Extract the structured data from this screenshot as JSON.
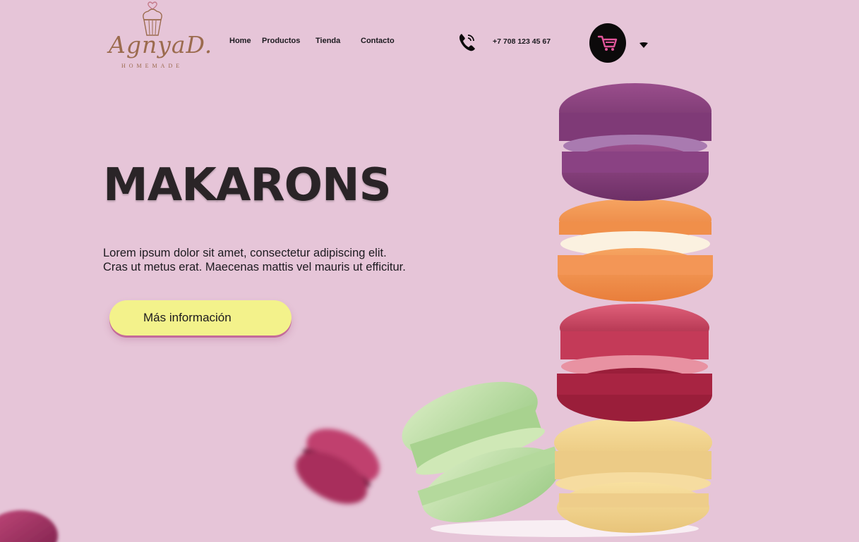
{
  "brand": {
    "name": "AgnyaD.",
    "tagline": "HOMEMADE"
  },
  "nav": {
    "items": [
      {
        "label": "Home",
        "active": true
      },
      {
        "label": "Productos",
        "active": false
      },
      {
        "label": "Tienda",
        "active": false
      },
      {
        "label": "Contacto",
        "active": false
      }
    ]
  },
  "contact": {
    "phone": "+7 708 123 45 67",
    "icon": "phone-icon"
  },
  "cart": {
    "icon": "shopping-cart-icon",
    "dropdown_icon": "caret-down-icon"
  },
  "hero": {
    "title": "MAKARONS",
    "description": "Lorem ipsum dolor sit amet, consectetur adipiscing elit. Cras ut metus erat. Maecenas mattis vel mauris ut efficitur.",
    "cta_label": "Más información"
  },
  "colors": {
    "background": "#e6c5d8",
    "cta": "#f3f28b",
    "cart_button": "#0c0a0b",
    "cart_icon": "#e0559a",
    "logo": "#9b6b4e",
    "title": "#2a2427"
  }
}
